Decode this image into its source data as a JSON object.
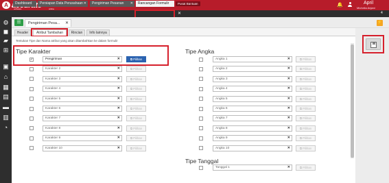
{
  "topbar": {
    "brand": "accurate",
    "brand_sub": "software",
    "brand_online": "online",
    "help_label": "Pusat Bantuan",
    "user_name": "April",
    "user_company": "Michelia Anjani"
  },
  "main_tabs": [
    {
      "label": "Dashboard"
    },
    {
      "label": "Persiapan Data Perusahaan"
    },
    {
      "label": "Pengiriman Pesanan"
    },
    {
      "label": "Rancangan Formulir"
    }
  ],
  "tab_count": "4",
  "sidebar_icons": [
    "gear-icon",
    "cube-icon",
    "tag-icon",
    "cart-icon",
    "bag-icon",
    "bank-icon",
    "calculator-icon",
    "grid-icon",
    "truck-icon",
    "factory-icon",
    "chart-icon"
  ],
  "form": {
    "tab_label": "Pengiriman Pesa...",
    "sub_tabs": [
      {
        "label": "Header"
      },
      {
        "label": "Atribut Tambahan"
      },
      {
        "label": "Rincian"
      },
      {
        "label": "Info lainnya"
      }
    ],
    "instruction": "Tentukan Tipe dan Nama atribut yang akan ditambahkan ke dalam formulir",
    "pilihan_label": "Pilihan"
  },
  "tipe_karakter": {
    "title": "Tipe Karakter",
    "rows": [
      {
        "label": "Pengiriman",
        "checked": true,
        "filled": true
      },
      {
        "label": "Karakter 2",
        "checked": false,
        "filled": false
      },
      {
        "label": "Karakter 3",
        "checked": false,
        "filled": false
      },
      {
        "label": "Karakter 4",
        "checked": false,
        "filled": false
      },
      {
        "label": "Karakter 5",
        "checked": false,
        "filled": false
      },
      {
        "label": "Karakter 6",
        "checked": false,
        "filled": false
      },
      {
        "label": "Karakter 7",
        "checked": false,
        "filled": false
      },
      {
        "label": "Karakter 8",
        "checked": false,
        "filled": false
      },
      {
        "label": "Karakter 9",
        "checked": false,
        "filled": false
      },
      {
        "label": "Karakter 10",
        "checked": false,
        "filled": false
      }
    ]
  },
  "tipe_angka": {
    "title": "Tipe Angka",
    "rows": [
      {
        "label": "Angka 1"
      },
      {
        "label": "Angka 2"
      },
      {
        "label": "Angka 3"
      },
      {
        "label": "Angka 4"
      },
      {
        "label": "Angka 5"
      },
      {
        "label": "Angka 6"
      },
      {
        "label": "Angka 7"
      },
      {
        "label": "Angka 8"
      },
      {
        "label": "Angka 9"
      },
      {
        "label": "Angka 10"
      }
    ]
  },
  "tipe_tanggal": {
    "title": "Tipe Tanggal",
    "rows": [
      {
        "label": "Tanggal 1"
      }
    ]
  },
  "colors": {
    "brand_red": "#b71c2a",
    "highlight": "#d61f2b",
    "pilihan_blue": "#2b63b0",
    "list_green": "#2e9e47",
    "orange": "#f5a623"
  }
}
